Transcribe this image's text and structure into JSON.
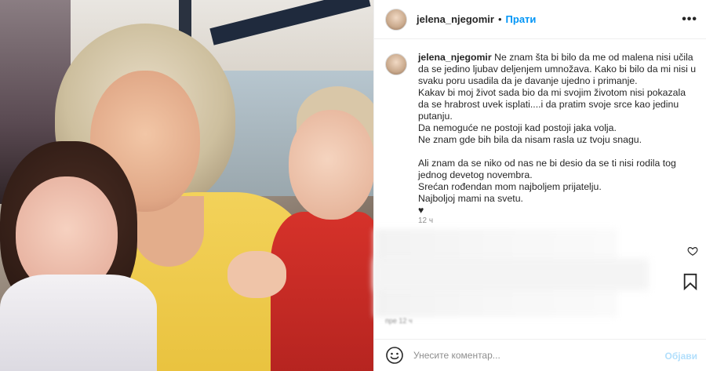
{
  "post": {
    "username": "jelena_njegomir",
    "dot": "•",
    "follow_label": "Прати",
    "more_label": "•••"
  },
  "caption": {
    "username": "jelena_njegomir",
    "lines": [
      "Ne znam šta bi bilo da me od malena nisi učila da se jedino ljubav deljenjem umnožava. Kako bi bilo da mi nisi u svaku poru usadila da je davanje ujedno i primanje.",
      "Kakav bi moj život sada bio da mi svojim životom nisi pokazala da se hrabrost uvek isplati....i da pratim svoje srce kao jedinu putanju.",
      "Da nemoguće ne postoji kad postoji jaka volja.",
      "Ne znam gde bih bila da nisam rasla uz tvoju snagu.",
      "",
      "Ali znam da se niko od nas ne bi desio da se ti nisi rodila tog jednog devetog novembra.",
      "Srećan rođendan mom najboljem prijatelju.",
      "Najboljoj mami na svetu.",
      "♥"
    ],
    "timestamp": "12 ч"
  },
  "blurred_text": "пре 12 ч",
  "actions": {
    "heart_icon": "heart-icon",
    "bookmark_icon": "bookmark-icon"
  },
  "comment": {
    "placeholder": "Унесите коментар...",
    "post_label": "Објави",
    "emoji_icon": "emoji-icon"
  },
  "colors": {
    "link": "#0095f6",
    "post_disabled": "#b2dffc",
    "muted": "#8e8e8e"
  }
}
